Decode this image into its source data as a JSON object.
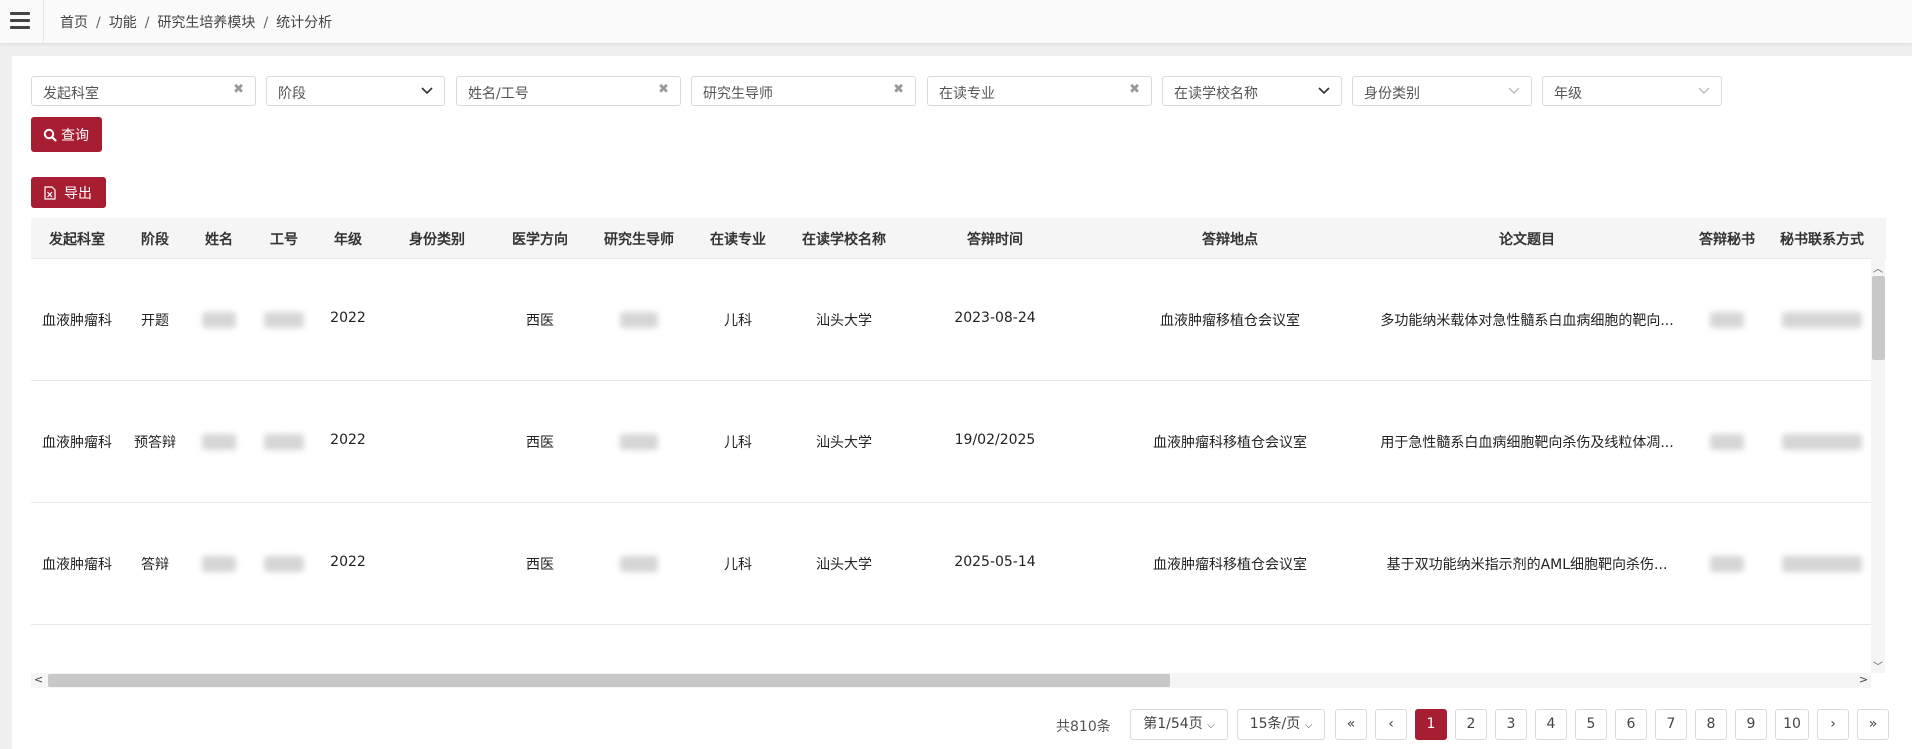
{
  "breadcrumb": [
    "首页",
    "功能",
    "研究生培养模块",
    "统计分析"
  ],
  "filters": {
    "dept": "发起科室",
    "stage": "阶段",
    "name_id": "姓名/工号",
    "supervisor": "研究生导师",
    "major": "在读专业",
    "school": "在读学校名称",
    "identity": "身份类别",
    "grade": "年级"
  },
  "buttons": {
    "query": "查询",
    "export": "导出"
  },
  "table": {
    "columns": [
      "发起科室",
      "阶段",
      "姓名",
      "工号",
      "年级",
      "身份类别",
      "医学方向",
      "研究生导师",
      "在读专业",
      "在读学校名称",
      "答辩时间",
      "答辩地点",
      "论文题目",
      "答辩秘书",
      "秘书联系方式"
    ],
    "rows": [
      {
        "dept": "血液肿瘤科",
        "stage": "开题",
        "grade": "2022",
        "direction": "西医",
        "major": "儿科",
        "school": "汕头大学",
        "date": "2023-08-24",
        "place": "血液肿瘤移植仓会议室",
        "title": "多功能纳米载体对急性髓系白血病细胞的靶向..."
      },
      {
        "dept": "血液肿瘤科",
        "stage": "预答辩",
        "grade": "2022",
        "direction": "西医",
        "major": "儿科",
        "school": "汕头大学",
        "date": "19/02/2025",
        "place": "血液肿瘤科移植仓会议室",
        "title": "用于急性髓系白血病细胞靶向杀伤及线粒体凋..."
      },
      {
        "dept": "血液肿瘤科",
        "stage": "答辩",
        "grade": "2022",
        "direction": "西医",
        "major": "儿科",
        "school": "汕头大学",
        "date": "2025-05-14",
        "place": "血液肿瘤科移植仓会议室",
        "title": "基于双功能纳米指示剂的AML细胞靶向杀伤..."
      }
    ]
  },
  "pagination": {
    "total": "共810条",
    "page_select": "第1/54页",
    "size_select": "15条/页",
    "first": "«",
    "prev": "‹",
    "pages": [
      "1",
      "2",
      "3",
      "4",
      "5",
      "6",
      "7",
      "8",
      "9",
      "10"
    ],
    "current": "1",
    "next": "›",
    "last": "»"
  },
  "colors": {
    "accent": "#a71d31"
  },
  "icons": {
    "menu": "hamburger-icon",
    "search": "search-icon",
    "export": "excel-file-icon",
    "clear": "close-icon",
    "dropdown": "chevron-down-icon"
  }
}
